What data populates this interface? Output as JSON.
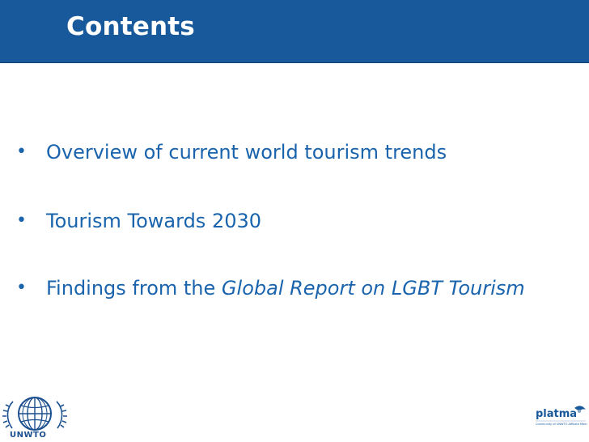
{
  "slide": {
    "title": "Contents",
    "bullets": [
      {
        "text": "Overview of current world tourism trends"
      },
      {
        "text": "Tourism Towards 2030"
      },
      {
        "text_prefix": "Findings from the ",
        "text_italic": "Global Report on LGBT Tourism"
      }
    ],
    "bullet_glyph": "•"
  },
  "footer": {
    "left_logo_label": "UNWTO",
    "right_logo_label": "platma",
    "right_logo_tagline": "Community of UNWTO Affiliate Members"
  },
  "colors": {
    "title_bar": "#17599a",
    "title_text": "#ffffff",
    "bullet_text": "#1a64ad"
  }
}
